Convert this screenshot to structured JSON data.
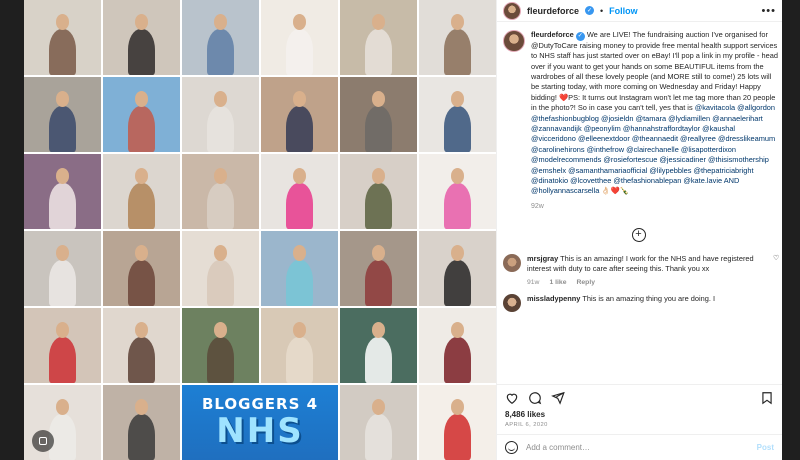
{
  "post": {
    "username": "fleurdeforce",
    "follow_label": "Follow",
    "more_label": "•••",
    "dot": "•"
  },
  "caption": {
    "username": "fleurdeforce",
    "text": "We are LIVE! The fundraising auction I've organised for @DutyToCare raising money to provide free mental health support services to NHS staff has just started over on eBay! I'll pop a link in my profile - head over if you want to get your hands on some BEAUTIFUL items from the wardrobes of all these lovely people (and MORE still to come!) 25 lots will be starting today, with more coming on Wednesday and Friday! Happy bidding! ❤️PS: It turns out Instagram won't let me tag more than 20 people in the photo?! So in case you can't tell, yes that is ",
    "tags": "@kavitacola @allgordon @thefashionbugblog @josieldn @tamara @lydiamillen @annaelerihart @zannavandijk @peonylim @hannahstraffordtaylor @kaushal @vicceridono @elleenextdoor @theannaedit @reallyree @dresslikeamum @carolinehirons @inthefrow @clairechanelle @lisapotterdixon @modelrecommends @rosiefortescue @jessicadiner @thisismothership @emshelx @samanthamariaofficial @lilypebbles @thepatriciabright @dinatokio @lcovetthee @thefashionablepan @kate.lavie AND @hollyannascarsella 👌🏻❤️🍾",
    "timeago": "92w"
  },
  "comments": [
    {
      "username": "mrsjgray",
      "text": "This is an amazing! I work for the NHS and have registered interest with duty to care after seeing this. Thank you xx",
      "time": "91w",
      "likes": "1 like",
      "reply": "Reply"
    },
    {
      "username": "missladypenny",
      "text": "This is an amazing thing you are doing. I",
      "time": "",
      "likes": "",
      "reply": ""
    }
  ],
  "stats": {
    "likes": "8,486 likes",
    "date": "APRIL 6, 2020"
  },
  "composer": {
    "placeholder": "Add a comment…",
    "post_label": "Post"
  },
  "banner": {
    "top": "BLOGGERS 4",
    "bottom": "NHS"
  },
  "icons": {
    "like": "heart-icon",
    "comment": "comment-icon",
    "share": "share-icon",
    "save": "bookmark-icon",
    "emoji": "emoji-icon",
    "load_more": "plus-circle-icon",
    "verified": "verified-badge-icon"
  },
  "colors": {
    "link": "#0095f6",
    "mention": "#00376b",
    "muted": "#8e8e8e",
    "text": "#262626",
    "post_disabled": "#b2dffc",
    "banner": "#1f6fbf"
  }
}
